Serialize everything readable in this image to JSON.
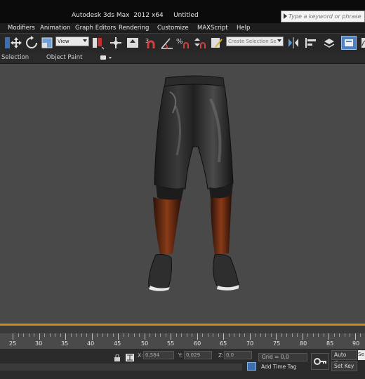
{
  "window": {
    "title": "Autodesk 3ds Max  2012 x64     Untitled"
  },
  "search": {
    "placeholder": "Type a keyword or phrase"
  },
  "menubar": {
    "items": [
      "Modifiers",
      "Animation",
      "Graph Editors",
      "Rendering",
      "Customize",
      "MAXScript",
      "Help"
    ]
  },
  "toolbar": {
    "view_dropdown": "View",
    "selection_set_placeholder": "Create Selection Se",
    "icons": [
      "select-move-icon",
      "rotate-icon",
      "scale-icon",
      "view-dropdown",
      "select-pivot-icon",
      "manipulate-icon",
      "keyboard-shortcut-icon",
      "snaps-toggle-icon",
      "angle-snap-icon",
      "percent-snap-icon",
      "spinner-snap-icon",
      "edit-named-selection-icon",
      "mirror-icon",
      "align-icon",
      "layer-manager-icon",
      "graphite-icon",
      "curve-editor-icon"
    ]
  },
  "ribbon": {
    "tabs": [
      "Selection",
      "Object Paint"
    ]
  },
  "timeline": {
    "tick_labels": [
      "25",
      "30",
      "35",
      "40",
      "45",
      "50",
      "55",
      "60",
      "65",
      "70",
      "75",
      "80",
      "85",
      "90"
    ]
  },
  "statusbar": {
    "x_label": "X:",
    "x_value": "0,584",
    "y_label": "Y:",
    "y_value": "0,029",
    "z_label": "Z:",
    "z_value": "0,0",
    "grid": "Grid = 0,0",
    "add_time_tag": "Add Time Tag",
    "auto_key": "Auto Key",
    "set_key": "Set Key",
    "selected": "Se"
  },
  "colors": {
    "viewport_bg": "#494949",
    "viewport_border": "#c98a1a",
    "accent": "#3a6fb0"
  }
}
